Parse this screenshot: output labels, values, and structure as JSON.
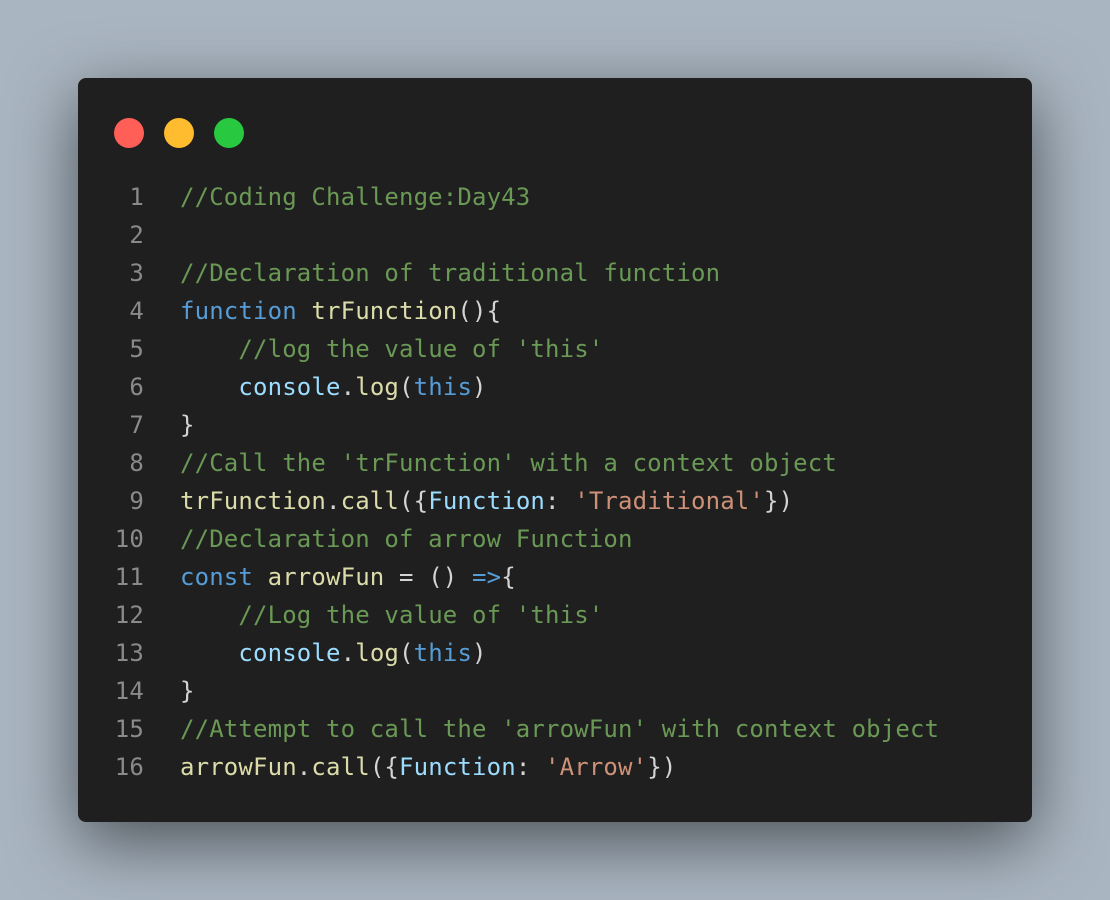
{
  "window": {
    "traffic_lights": [
      {
        "name": "close",
        "color": "#ff5f57"
      },
      {
        "name": "minimize",
        "color": "#febc2e"
      },
      {
        "name": "maximize",
        "color": "#28c840"
      }
    ]
  },
  "editor": {
    "lines": [
      {
        "number": "1",
        "tokens": [
          {
            "text": "//Coding Challenge:Day43",
            "type": "comment"
          }
        ]
      },
      {
        "number": "2",
        "tokens": []
      },
      {
        "number": "3",
        "tokens": [
          {
            "text": "//Declaration of traditional function",
            "type": "comment"
          }
        ]
      },
      {
        "number": "4",
        "tokens": [
          {
            "text": "function",
            "type": "keyword"
          },
          {
            "text": " ",
            "type": "plain"
          },
          {
            "text": "trFunction",
            "type": "function"
          },
          {
            "text": "(){",
            "type": "punct"
          }
        ]
      },
      {
        "number": "5",
        "tokens": [
          {
            "text": "    ",
            "type": "plain"
          },
          {
            "text": "//log the value of 'this'",
            "type": "comment"
          }
        ]
      },
      {
        "number": "6",
        "tokens": [
          {
            "text": "    ",
            "type": "plain"
          },
          {
            "text": "console",
            "type": "variable"
          },
          {
            "text": ".",
            "type": "punct"
          },
          {
            "text": "log",
            "type": "function"
          },
          {
            "text": "(",
            "type": "punct"
          },
          {
            "text": "this",
            "type": "keyword"
          },
          {
            "text": ")",
            "type": "punct"
          }
        ]
      },
      {
        "number": "7",
        "tokens": [
          {
            "text": "}",
            "type": "punct"
          }
        ]
      },
      {
        "number": "8",
        "tokens": [
          {
            "text": "//Call the 'trFunction' with a context object",
            "type": "comment"
          }
        ]
      },
      {
        "number": "9",
        "tokens": [
          {
            "text": "trFunction",
            "type": "function"
          },
          {
            "text": ".",
            "type": "punct"
          },
          {
            "text": "call",
            "type": "function"
          },
          {
            "text": "({",
            "type": "punct"
          },
          {
            "text": "Function",
            "type": "variable"
          },
          {
            "text": ": ",
            "type": "punct"
          },
          {
            "text": "'Traditional'",
            "type": "string"
          },
          {
            "text": "})",
            "type": "punct"
          }
        ]
      },
      {
        "number": "10",
        "tokens": [
          {
            "text": "//Declaration of arrow Function",
            "type": "comment"
          }
        ]
      },
      {
        "number": "11",
        "tokens": [
          {
            "text": "const",
            "type": "keyword"
          },
          {
            "text": " ",
            "type": "plain"
          },
          {
            "text": "arrowFun",
            "type": "function"
          },
          {
            "text": " = () ",
            "type": "punct"
          },
          {
            "text": "=>",
            "type": "keyword"
          },
          {
            "text": "{",
            "type": "punct"
          }
        ]
      },
      {
        "number": "12",
        "tokens": [
          {
            "text": "    ",
            "type": "plain"
          },
          {
            "text": "//Log the value of 'this'",
            "type": "comment"
          }
        ]
      },
      {
        "number": "13",
        "tokens": [
          {
            "text": "    ",
            "type": "plain"
          },
          {
            "text": "console",
            "type": "variable"
          },
          {
            "text": ".",
            "type": "punct"
          },
          {
            "text": "log",
            "type": "function"
          },
          {
            "text": "(",
            "type": "punct"
          },
          {
            "text": "this",
            "type": "keyword"
          },
          {
            "text": ")",
            "type": "punct"
          }
        ]
      },
      {
        "number": "14",
        "tokens": [
          {
            "text": "}",
            "type": "punct"
          }
        ]
      },
      {
        "number": "15",
        "tokens": [
          {
            "text": "//Attempt to call the 'arrowFun' with context object",
            "type": "comment"
          }
        ]
      },
      {
        "number": "16",
        "tokens": [
          {
            "text": "arrowFun",
            "type": "function"
          },
          {
            "text": ".",
            "type": "punct"
          },
          {
            "text": "call",
            "type": "function"
          },
          {
            "text": "({",
            "type": "punct"
          },
          {
            "text": "Function",
            "type": "variable"
          },
          {
            "text": ": ",
            "type": "punct"
          },
          {
            "text": "'Arrow'",
            "type": "string"
          },
          {
            "text": "})",
            "type": "punct"
          }
        ]
      }
    ]
  }
}
